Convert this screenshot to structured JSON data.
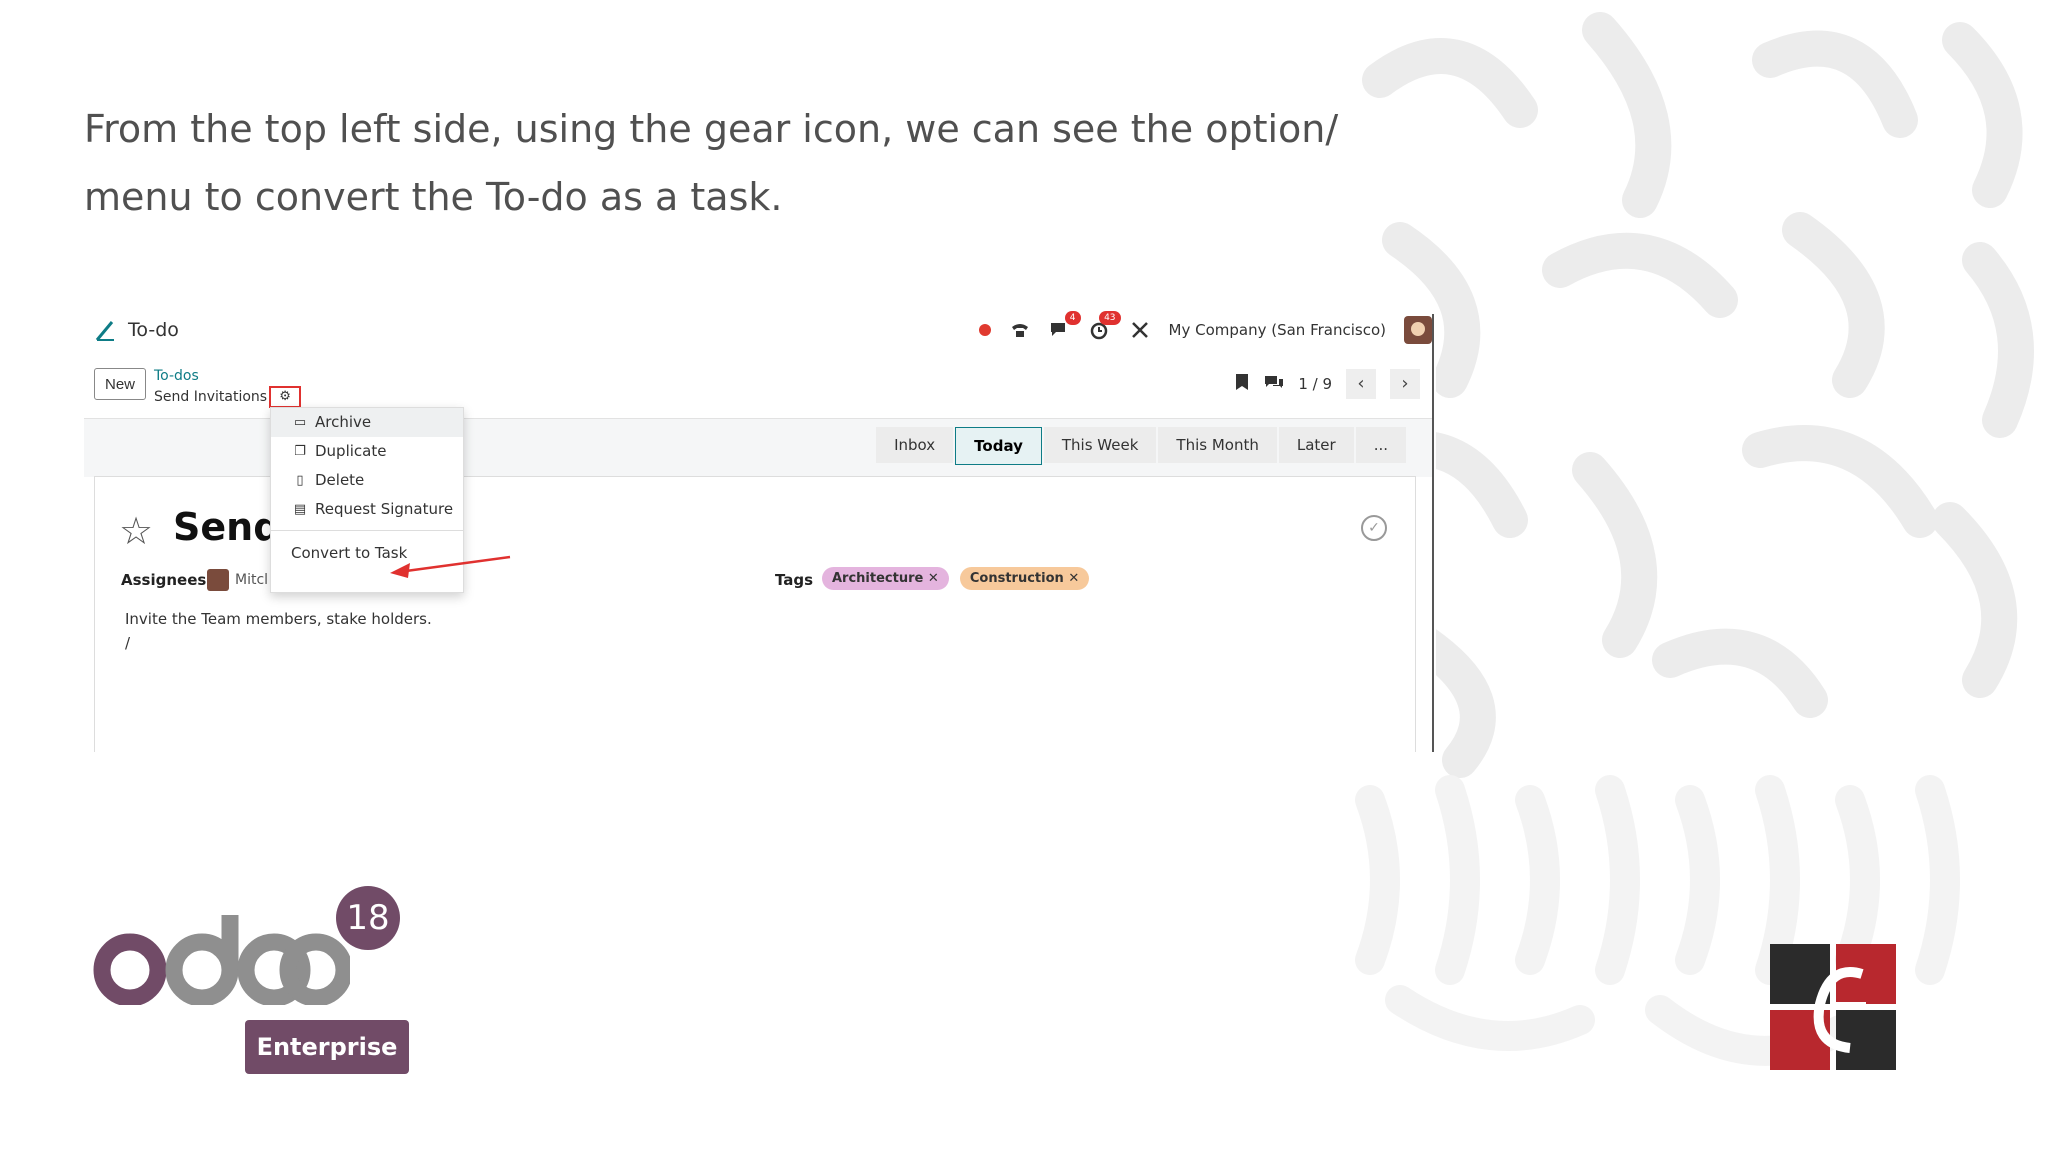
{
  "slide": {
    "text": "From the top left side, using the gear icon, we can see the option/ menu to convert the To-do as a task."
  },
  "app": {
    "title": "To-do",
    "company": "My Company (San Francisco)",
    "badges": {
      "chat": "4",
      "activity": "43"
    }
  },
  "control": {
    "new_label": "New",
    "breadcrumb_parent": "To-dos",
    "breadcrumb_current": "Send Invitations",
    "pager": "1 / 9"
  },
  "stages": [
    "Inbox",
    "Today",
    "This Week",
    "This Month",
    "Later",
    "..."
  ],
  "menu": {
    "archive": "Archive",
    "duplicate": "Duplicate",
    "delete": "Delete",
    "request_signature": "Request Signature",
    "convert": "Convert to Task"
  },
  "record": {
    "title_visible": "Send I",
    "assignees_label": "Assignees",
    "assignee": "Mitcl",
    "tags_label": "Tags",
    "tags": [
      "Architecture",
      "Construction"
    ],
    "description": "Invite the Team members, stake holders.",
    "description_line2": "/"
  },
  "branding": {
    "version": "18",
    "edition": "Enterprise"
  },
  "colors": {
    "odoo_purple": "#714b67",
    "teal": "#0e7c86",
    "highlight_red": "#e0312f"
  }
}
